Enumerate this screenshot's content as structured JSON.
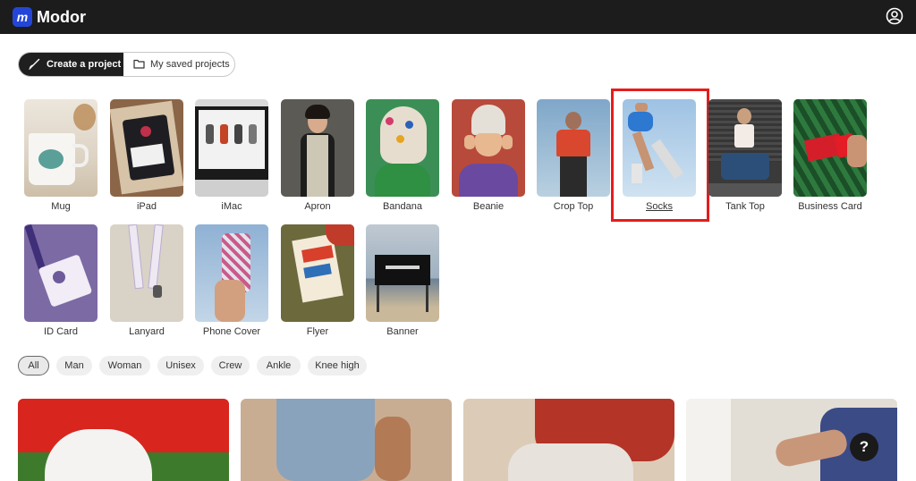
{
  "app": {
    "name": "Modor",
    "logo_letter": "m"
  },
  "header": {
    "user_icon": "user-circle-icon"
  },
  "project_tabs": {
    "create_label": "Create a project",
    "saved_label": "My saved projects"
  },
  "products": [
    {
      "label": "Mug"
    },
    {
      "label": "iPad"
    },
    {
      "label": "iMac"
    },
    {
      "label": "Apron"
    },
    {
      "label": "Bandana"
    },
    {
      "label": "Beanie"
    },
    {
      "label": "Crop Top"
    },
    {
      "label": "Socks"
    },
    {
      "label": "Tank Top"
    },
    {
      "label": "Business Card"
    },
    {
      "label": "ID Card"
    },
    {
      "label": "Lanyard"
    },
    {
      "label": "Phone Cover"
    },
    {
      "label": "Flyer"
    },
    {
      "label": "Banner"
    }
  ],
  "selected_product": "Socks",
  "filters": [
    "All",
    "Man",
    "Woman",
    "Unisex",
    "Crew",
    "Ankle",
    "Knee high"
  ],
  "active_filter": "All",
  "help_label": "?",
  "colors": {
    "topbar": "#1c1c1c",
    "brand_blue": "#2446d8",
    "highlight_red": "#e41d1d"
  }
}
